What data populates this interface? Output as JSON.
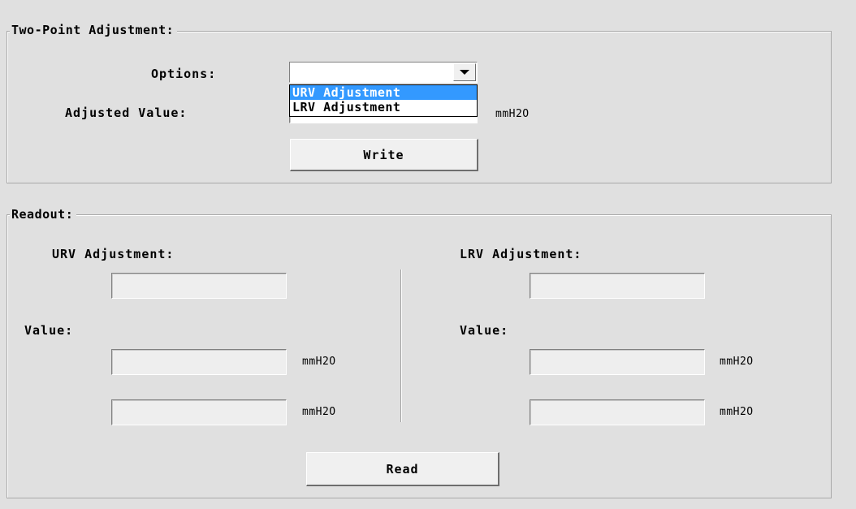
{
  "two_point": {
    "legend": "Two-Point Adjustment:",
    "options_label": "Options:",
    "options_selected": "",
    "dropdown_options": [
      "URV Adjustment",
      "LRV Adjustment"
    ],
    "adjusted_value_label": "Adjusted Value:",
    "adjusted_value": "",
    "unit": "mmH2O",
    "write_button": "Write"
  },
  "readout": {
    "legend": "Readout:",
    "urv": {
      "title": "URV Adjustment:",
      "field": "",
      "value_label": "Value:",
      "value1": "",
      "value2": "",
      "unit1": "mmH2O",
      "unit2": "mmH2O"
    },
    "lrv": {
      "title": "LRV Adjustment:",
      "field": "",
      "value_label": "Value:",
      "value1": "",
      "value2": "",
      "unit1": "mmH2O",
      "unit2": "mmH2O"
    },
    "read_button": "Read"
  }
}
